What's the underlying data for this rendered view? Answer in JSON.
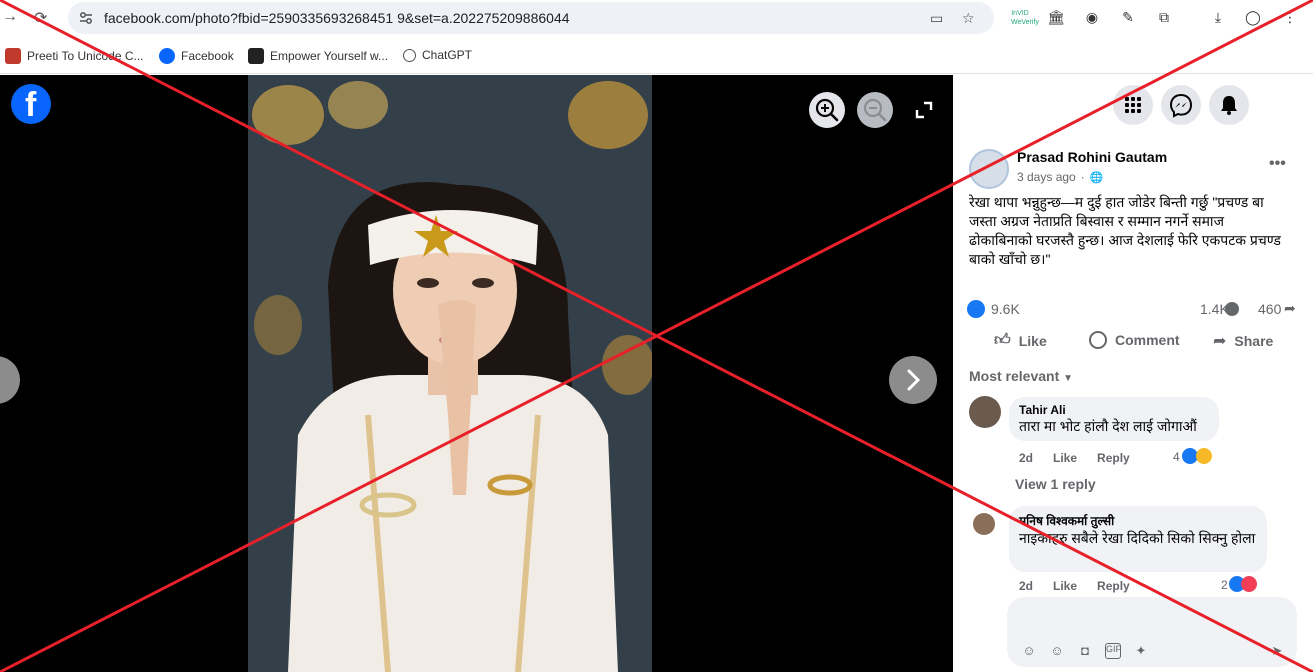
{
  "browser": {
    "url": "facebook.com/photo?fbid=2590335693268451 9&set=a.202275209886044",
    "extension_label": "InVID WeVerify"
  },
  "bookmarks": [
    {
      "label": "Preeti To Unicode C..."
    },
    {
      "label": "Facebook"
    },
    {
      "label": "Empower Yourself w..."
    },
    {
      "label": "ChatGPT"
    }
  ],
  "viewer": {
    "logo": "f"
  },
  "post": {
    "author": "Prasad Rohini Gautam",
    "time": "3 days ago",
    "text": "रेखा थापा भन्नुहुन्छ—म दुई हात जोडेर बिन्ती गर्छु \"प्रचण्ड बा जस्ता अग्रज नेताप्रति बिस्वास र सम्मान नगर्ने समाज ढोकाबिनाको घरजस्तै हुन्छ। आज देशलाई फेरि एकपटक प्रचण्ड बाको खाँचो छ।\"",
    "reactions": "9.6K",
    "comments_count": "1.4K",
    "shares_count": "460",
    "like_label": "Like",
    "comment_label": "Comment",
    "share_label": "Share",
    "sort_label": "Most relevant"
  },
  "comments": [
    {
      "name": "Tahir Ali",
      "text": "तारा मा भोट हांलौ देश लाई जोगाऔं",
      "time": "2d",
      "like": "Like",
      "reply": "Reply",
      "count": "4"
    },
    {
      "name": "मनिष विश्वकर्मा तुल्सी",
      "text": "नाइकाहरु सबैले रेखा दिदिको सिको सिक्नु होला",
      "time": "2d",
      "like": "Like",
      "reply": "Reply",
      "count": "2"
    }
  ],
  "view_replies": "View 1 reply",
  "colors": {
    "facebook_blue": "#0866ff",
    "x_overlay": "#e8202a"
  }
}
